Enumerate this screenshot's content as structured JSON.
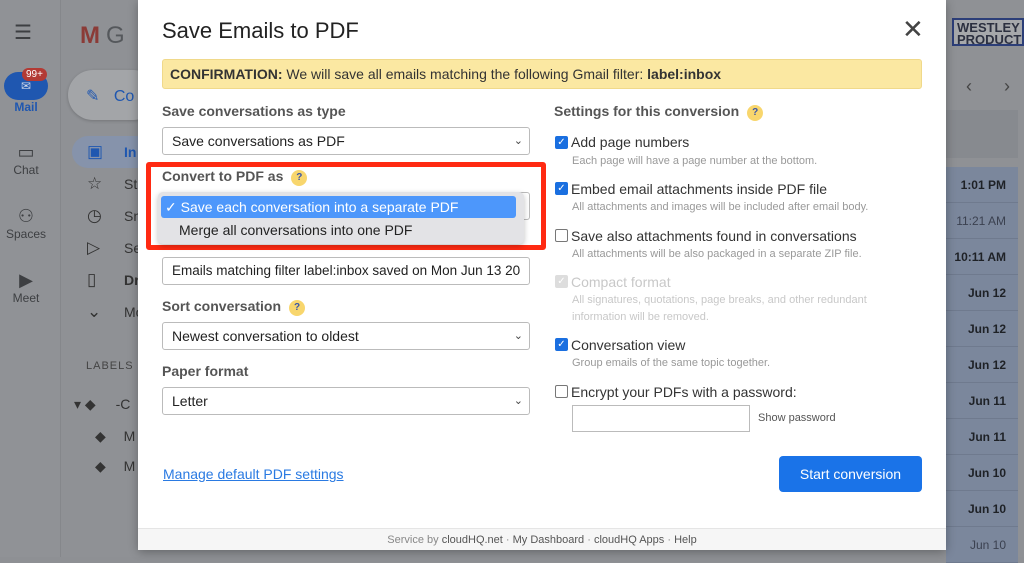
{
  "gmail": {
    "rail": [
      {
        "label": "Mail",
        "icon": "mail-icon",
        "badge": "99+"
      },
      {
        "label": "Chat",
        "icon": "chat-icon"
      },
      {
        "label": "Spaces",
        "icon": "spaces-icon"
      },
      {
        "label": "Meet",
        "icon": "meet-icon"
      }
    ],
    "logo_letter": "G",
    "compose": "Co",
    "nav": [
      {
        "label": "In",
        "icon": "inbox-icon"
      },
      {
        "label": "St",
        "icon": "star-icon"
      },
      {
        "label": "Sn",
        "icon": "clock-icon"
      },
      {
        "label": "Se",
        "icon": "send-icon"
      },
      {
        "label": "Dr",
        "icon": "draft-icon"
      },
      {
        "label": "Mo",
        "icon": "chevron-down-icon"
      }
    ],
    "labels_heading": "LABELS",
    "labels": [
      "-C",
      "M",
      "M"
    ],
    "brand_logo": "WESTLEY PRODUCTIONS",
    "times": [
      "1:01 PM",
      "11:21 AM",
      "10:11 AM",
      "Jun 12",
      "Jun 12",
      "Jun 12",
      "Jun 11",
      "Jun 11",
      "Jun 10",
      "Jun 10",
      "Jun 10"
    ]
  },
  "dialog": {
    "title": "Save Emails to PDF",
    "banner_strong": "CONFIRMATION:",
    "banner_text": " We will save all emails matching the following Gmail filter: ",
    "banner_filter": "label:inbox",
    "save_type_label": "Save conversations as type",
    "save_type_value": "Save conversations as PDF",
    "convert_label": "Convert to PDF as",
    "convert_options": [
      {
        "label": "Save each conversation into a separate PDF",
        "selected": true
      },
      {
        "label": "Merge all conversations into one PDF",
        "selected": false
      }
    ],
    "filename_value": "Emails matching filter label:inbox saved on Mon Jun 13 20",
    "sort_label": "Sort conversation",
    "sort_value": "Newest conversation to oldest",
    "paper_label": "Paper format",
    "paper_value": "Letter",
    "settings_label": "Settings for this conversion",
    "settings": [
      {
        "label": "Add page numbers",
        "desc": "Each page will have a page number at the bottom.",
        "checked": true
      },
      {
        "label": "Embed email attachments inside PDF file",
        "desc": "All attachments and images will be included after email body.",
        "checked": true
      },
      {
        "label": "Save also attachments found in conversations",
        "desc": "All attachments will be also packaged in a separate ZIP file.",
        "checked": false
      },
      {
        "label": "Compact format",
        "desc": "All signatures, quotations, page breaks, and other redundant information will be removed.",
        "checked": true,
        "disabled": true
      },
      {
        "label": "Conversation view",
        "desc": "Group emails of the same topic together.",
        "checked": true
      },
      {
        "label": "Encrypt your PDFs with a password:",
        "checked": false
      }
    ],
    "password_value": "",
    "show_password": "Show password",
    "manage_link": "Manage default PDF settings",
    "start_button": "Start conversion",
    "footer": {
      "service_by": "Service by ",
      "cloudhq": "cloudHQ.net",
      "dashboard": "My Dashboard",
      "apps": "cloudHQ Apps",
      "help": "Help",
      "sep": " · "
    }
  },
  "colors": {
    "accent": "#1a73e8",
    "highlight": "#ff2a12",
    "banner": "#fbe8a2"
  }
}
